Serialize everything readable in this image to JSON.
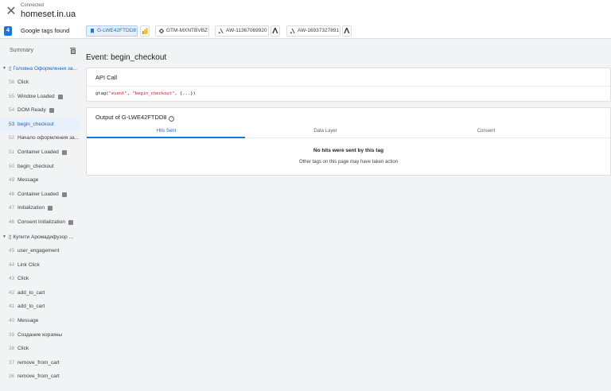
{
  "header": {
    "status": "Connected",
    "site": "homeset.in.ua"
  },
  "tagbar": {
    "count": "4",
    "label": "Google tags found",
    "chips": [
      {
        "label": "G-LWE42FTDD8",
        "icon": "ga-icon"
      },
      {
        "label": "GTM-MXNTBVBZ",
        "icon": "gtm-icon"
      },
      {
        "label": "AW-11367069920",
        "icon": "google-ads-icon"
      },
      {
        "label": "AW-16937327891",
        "icon": "google-ads-icon"
      }
    ]
  },
  "sidebar": {
    "summary_label": "Summary",
    "groups": [
      {
        "label": "Головна Оформлення за...",
        "icon": "page-icon"
      },
      {
        "label": "Купити Аромадифузор ...",
        "icon": "page-icon"
      }
    ],
    "events_group1": [
      {
        "num": "56",
        "label": "Click",
        "icon": false
      },
      {
        "num": "55",
        "label": "Window Loaded",
        "icon": true
      },
      {
        "num": "54",
        "label": "DOM Ready",
        "icon": true
      },
      {
        "num": "53",
        "label": "begin_checkout",
        "icon": false
      },
      {
        "num": "52",
        "label": "Начало оформления за...",
        "icon": false
      },
      {
        "num": "51",
        "label": "Container Loaded",
        "icon": true
      },
      {
        "num": "50",
        "label": "begin_checkout",
        "icon": false
      },
      {
        "num": "49",
        "label": "Message",
        "icon": false
      },
      {
        "num": "48",
        "label": "Container Loaded",
        "icon": true
      },
      {
        "num": "47",
        "label": "Initialization",
        "icon": true
      },
      {
        "num": "46",
        "label": "Consent Initialization",
        "icon": true
      }
    ],
    "events_group2": [
      {
        "num": "45",
        "label": "user_engagement",
        "icon": false
      },
      {
        "num": "44",
        "label": "Link Click",
        "icon": false
      },
      {
        "num": "43",
        "label": "Click",
        "icon": false
      },
      {
        "num": "42",
        "label": "add_to_cart",
        "icon": false
      },
      {
        "num": "41",
        "label": "add_to_cart",
        "icon": false
      },
      {
        "num": "40",
        "label": "Message",
        "icon": false
      },
      {
        "num": "39",
        "label": "Создание корзины",
        "icon": false
      },
      {
        "num": "38",
        "label": "Click",
        "icon": false
      },
      {
        "num": "37",
        "label": "remove_from_cart",
        "icon": false
      },
      {
        "num": "36",
        "label": "remove_from_cart",
        "icon": false
      }
    ]
  },
  "main": {
    "title": "Event: begin_checkout",
    "api_call": {
      "header": "API Call",
      "code_prefix": "gtag(",
      "code_arg1": "\"event\"",
      "code_sep": ", ",
      "code_arg2": "\"begin_checkout\"",
      "code_suffix": ", {...})"
    },
    "output": {
      "header": "Output of G-LWE42FTDD8",
      "help_icon": "?",
      "tabs": [
        "Hits Sent",
        "Data Layer",
        "Consent"
      ],
      "empty_title": "No hits were sent by this tag",
      "empty_subtitle": "Other tags on this page may have taken action"
    }
  },
  "colors": {
    "accent": "#1a73e8",
    "selected_bg": "#e8f0fe",
    "ga_orange": "#f9ab00"
  }
}
